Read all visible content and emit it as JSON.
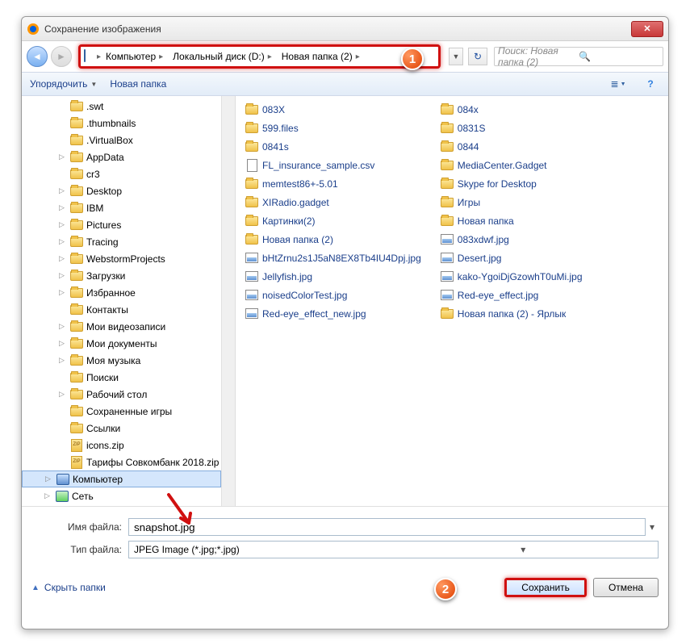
{
  "window": {
    "title": "Сохранение изображения"
  },
  "breadcrumb": {
    "segments": [
      "Компьютер",
      "Локальный диск (D:)",
      "Новая папка (2)"
    ]
  },
  "search": {
    "placeholder": "Поиск: Новая папка (2)"
  },
  "toolbar": {
    "organize": "Упорядочить",
    "new_folder": "Новая папка"
  },
  "tree": {
    "items": [
      {
        "label": ".swt",
        "type": "folder",
        "indent": 1
      },
      {
        "label": ".thumbnails",
        "type": "folder",
        "indent": 1
      },
      {
        "label": ".VirtualBox",
        "type": "folder",
        "indent": 1
      },
      {
        "label": "AppData",
        "type": "folder",
        "indent": 1,
        "expandable": true
      },
      {
        "label": "cr3",
        "type": "folder",
        "indent": 1
      },
      {
        "label": "Desktop",
        "type": "folder",
        "indent": 1,
        "expandable": true
      },
      {
        "label": "IBM",
        "type": "folder",
        "indent": 1,
        "expandable": true
      },
      {
        "label": "Pictures",
        "type": "folder",
        "indent": 1,
        "expandable": true
      },
      {
        "label": "Tracing",
        "type": "folder",
        "indent": 1,
        "expandable": true
      },
      {
        "label": "WebstormProjects",
        "type": "folder",
        "indent": 1,
        "expandable": true
      },
      {
        "label": "Загрузки",
        "type": "folder",
        "indent": 1,
        "expandable": true
      },
      {
        "label": "Избранное",
        "type": "folder",
        "indent": 1,
        "expandable": true
      },
      {
        "label": "Контакты",
        "type": "folder",
        "indent": 1
      },
      {
        "label": "Мои видеозаписи",
        "type": "folder",
        "indent": 1,
        "expandable": true
      },
      {
        "label": "Мои документы",
        "type": "folder",
        "indent": 1,
        "expandable": true
      },
      {
        "label": "Моя музыка",
        "type": "folder",
        "indent": 1,
        "expandable": true
      },
      {
        "label": "Поиски",
        "type": "folder",
        "indent": 1
      },
      {
        "label": "Рабочий стол",
        "type": "folder",
        "indent": 1,
        "expandable": true
      },
      {
        "label": "Сохраненные игры",
        "type": "folder",
        "indent": 1
      },
      {
        "label": "Ссылки",
        "type": "folder",
        "indent": 1
      },
      {
        "label": "icons.zip",
        "type": "zip",
        "indent": 1
      },
      {
        "label": "Тарифы Совкомбанк 2018.zip",
        "type": "zip",
        "indent": 1
      },
      {
        "label": "Компьютер",
        "type": "computer",
        "indent": 0,
        "expandable": true,
        "selected": true
      },
      {
        "label": "Сеть",
        "type": "network",
        "indent": 0,
        "expandable": true
      }
    ]
  },
  "files": {
    "col1": [
      {
        "label": "083X",
        "type": "folder"
      },
      {
        "label": "599.files",
        "type": "folder"
      },
      {
        "label": "0841s",
        "type": "folder"
      },
      {
        "label": "FL_insurance_sample.csv",
        "type": "file"
      },
      {
        "label": "memtest86+-5.01",
        "type": "folder"
      },
      {
        "label": "XIRadio.gadget",
        "type": "folder"
      },
      {
        "label": "Картинки(2)",
        "type": "folder"
      },
      {
        "label": "Новая папка (2)",
        "type": "folder"
      },
      {
        "label": "bHtZrnu2s1J5aN8EX8Tb4IU4Dpj.jpg",
        "type": "image"
      },
      {
        "label": "Jellyfish.jpg",
        "type": "image"
      },
      {
        "label": "noisedColorTest.jpg",
        "type": "image"
      },
      {
        "label": "Red-eye_effect_new.jpg",
        "type": "image"
      }
    ],
    "col2": [
      {
        "label": "084x",
        "type": "folder"
      },
      {
        "label": "0831S",
        "type": "folder"
      },
      {
        "label": "0844",
        "type": "folder"
      },
      {
        "label": "MediaCenter.Gadget",
        "type": "folder"
      },
      {
        "label": "Skype for Desktop",
        "type": "folder"
      },
      {
        "label": "Игры",
        "type": "folder"
      },
      {
        "label": "Новая папка",
        "type": "folder"
      },
      {
        "label": "083xdwf.jpg",
        "type": "image"
      },
      {
        "label": "Desert.jpg",
        "type": "image"
      },
      {
        "label": "kako-YgoiDjGzowhT0uMi.jpg",
        "type": "image"
      },
      {
        "label": "Red-eye_effect.jpg",
        "type": "image"
      },
      {
        "label": "Новая папка (2) - Ярлык",
        "type": "shortcut"
      }
    ]
  },
  "form": {
    "filename_label": "Имя файла:",
    "filename_value": "snapshot.jpg",
    "filetype_label": "Тип файла:",
    "filetype_value": "JPEG Image (*.jpg;*.jpg)"
  },
  "buttons": {
    "hide_folders": "Скрыть папки",
    "save": "Сохранить",
    "cancel": "Отмена"
  },
  "callouts": {
    "one": "1",
    "two": "2"
  }
}
